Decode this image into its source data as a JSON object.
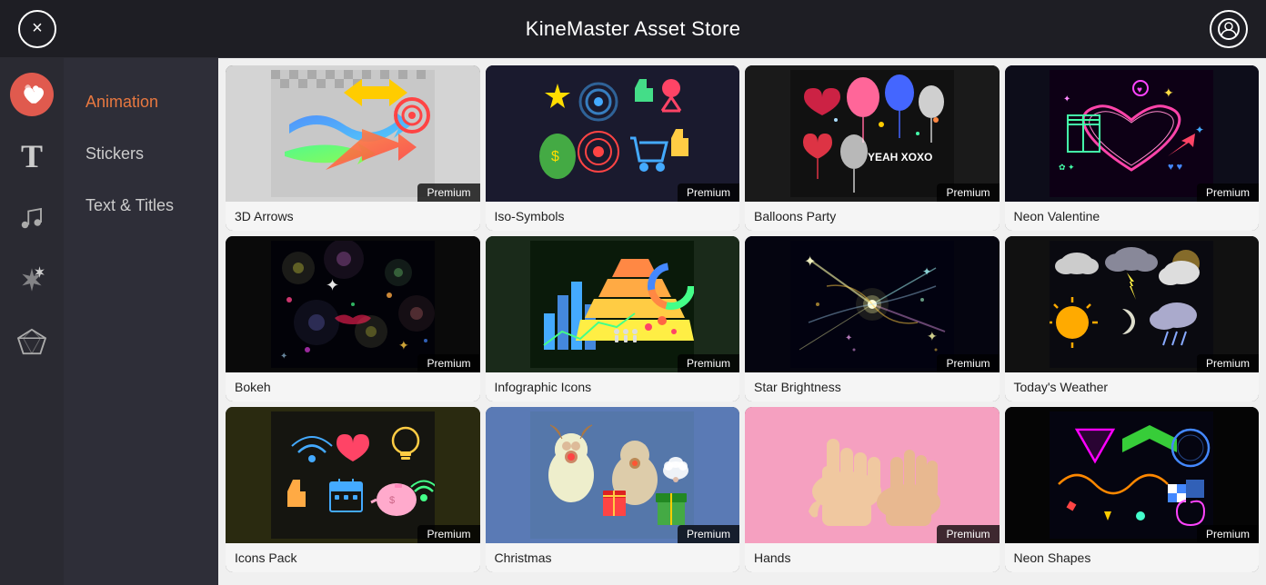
{
  "header": {
    "title": "KineMaster Asset Store",
    "close_label": "×",
    "profile_label": "👤"
  },
  "icon_sidebar": {
    "items": [
      {
        "id": "favorites",
        "icon": "heart",
        "label": "Favorites"
      },
      {
        "id": "text",
        "icon": "T",
        "label": "Text"
      },
      {
        "id": "music",
        "icon": "♪",
        "label": "Music"
      },
      {
        "id": "effects",
        "icon": "✦",
        "label": "Effects"
      },
      {
        "id": "premium",
        "icon": "◆",
        "label": "Premium"
      }
    ]
  },
  "category_nav": {
    "items": [
      {
        "id": "animation",
        "label": "Animation",
        "active": true
      },
      {
        "id": "stickers",
        "label": "Stickers",
        "active": false
      },
      {
        "id": "text-titles",
        "label": "Text & Titles",
        "active": false
      }
    ]
  },
  "grid": {
    "items": [
      {
        "id": "3d-arrows",
        "label": "3D Arrows",
        "badge": "Premium",
        "bg": "arrows"
      },
      {
        "id": "iso-symbols",
        "label": "Iso-Symbols",
        "badge": "Premium",
        "bg": "iso"
      },
      {
        "id": "balloons-party",
        "label": "Balloons Party",
        "badge": "Premium",
        "bg": "balloons"
      },
      {
        "id": "neon-valentine",
        "label": "Neon Valentine",
        "badge": "Premium",
        "bg": "neon-valentine"
      },
      {
        "id": "bokeh",
        "label": "Bokeh",
        "badge": "Premium",
        "bg": "bokeh"
      },
      {
        "id": "infographic-icons",
        "label": "Infographic Icons",
        "badge": "Premium",
        "bg": "infographic"
      },
      {
        "id": "star-brightness",
        "label": "Star Brightness",
        "badge": "Premium",
        "bg": "star"
      },
      {
        "id": "todays-weather",
        "label": "Today's Weather",
        "badge": "Premium",
        "bg": "weather"
      },
      {
        "id": "icons-pack",
        "label": "Icons Pack",
        "badge": "Premium",
        "bg": "icons"
      },
      {
        "id": "christmas",
        "label": "Christmas",
        "badge": "Premium",
        "bg": "christmas"
      },
      {
        "id": "hands",
        "label": "Hands",
        "badge": "Premium",
        "bg": "hands"
      },
      {
        "id": "neon-shapes",
        "label": "Neon Shapes",
        "badge": "Premium",
        "bg": "neon-shapes"
      }
    ]
  }
}
